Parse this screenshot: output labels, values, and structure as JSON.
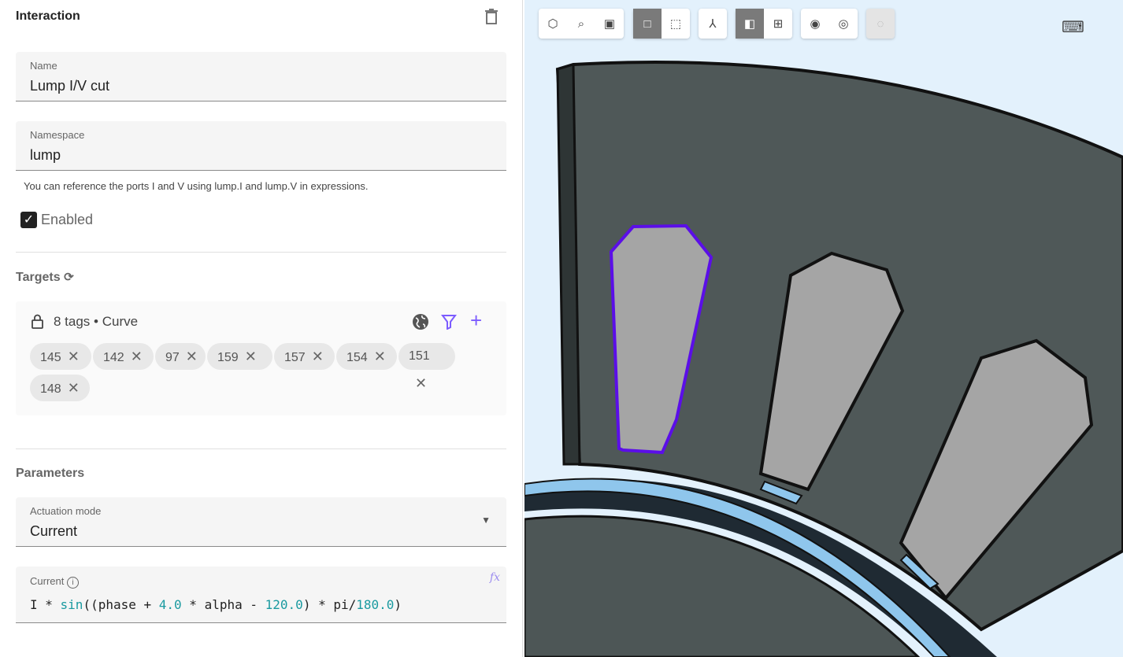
{
  "panel": {
    "title": "Interaction",
    "name": {
      "label": "Name",
      "value": "Lump I/V cut"
    },
    "namespace": {
      "label": "Namespace",
      "value": "lump",
      "help": "You can reference the ports I and V using lump.I and lump.V in expressions."
    },
    "enabled": {
      "label": "Enabled",
      "checked": true
    },
    "targets": {
      "title": "Targets",
      "summary": "8 tags • Curve",
      "tags": [
        "145",
        "142",
        "97",
        "159",
        "157",
        "154",
        "151",
        "148"
      ]
    },
    "parameters": {
      "title": "Parameters",
      "actuation_mode": {
        "label": "Actuation mode",
        "value": "Current"
      },
      "current": {
        "label": "Current",
        "expr": {
          "a": "I * ",
          "b": "sin",
          "c": "((phase + ",
          "d": "4.0",
          "e": " * alpha - ",
          "f": "120.0",
          "g": ") * pi/",
          "h": "180.0",
          "i": ")"
        }
      }
    }
  },
  "toolbar": {
    "groups": [
      [
        "focus-icon",
        "zoom-fit-icon",
        "zoom-box-icon"
      ],
      [
        "solid-select-icon",
        "box-select-icon"
      ],
      [
        "axes-icon"
      ],
      [
        "section-icon",
        "grid-icon"
      ],
      [
        "hide-icon",
        "show-icon"
      ],
      [
        "show-all-icon"
      ]
    ]
  },
  "colors": {
    "accent": "#7c5cff",
    "selection": "#5b0ee8",
    "viewport_bg": "#e3f1fc"
  }
}
